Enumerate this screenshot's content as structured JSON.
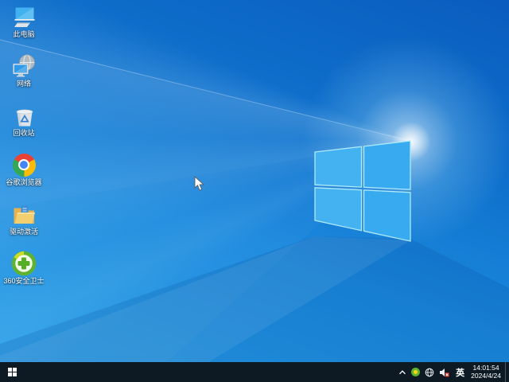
{
  "desktop": {
    "icons": [
      {
        "id": "this-pc",
        "label": "此电脑"
      },
      {
        "id": "network",
        "label": "网络"
      },
      {
        "id": "recycle-bin",
        "label": "回收站"
      },
      {
        "id": "chrome",
        "label": "谷歌浏览器"
      },
      {
        "id": "driver-activation",
        "label": "驱动激活"
      },
      {
        "id": "360-safety",
        "label": "360安全卫士"
      }
    ]
  },
  "taskbar": {
    "ime_indicator": "英",
    "clock": {
      "time": "14:01:54",
      "date": "2024/4/24"
    }
  },
  "colors": {
    "taskbar_bg": "#0d1a24",
    "wallpaper_dark": "#0a5cbe",
    "wallpaper_light": "#2aa0e9",
    "logo_pane": "#3caef0",
    "logo_edge": "#aeeafc",
    "chrome_red": "#ea4335",
    "chrome_yellow": "#fbbc05",
    "chrome_green": "#34a853",
    "chrome_blue": "#4285f4",
    "safety_green": "#5eb331",
    "mute_red": "#e03c31"
  }
}
